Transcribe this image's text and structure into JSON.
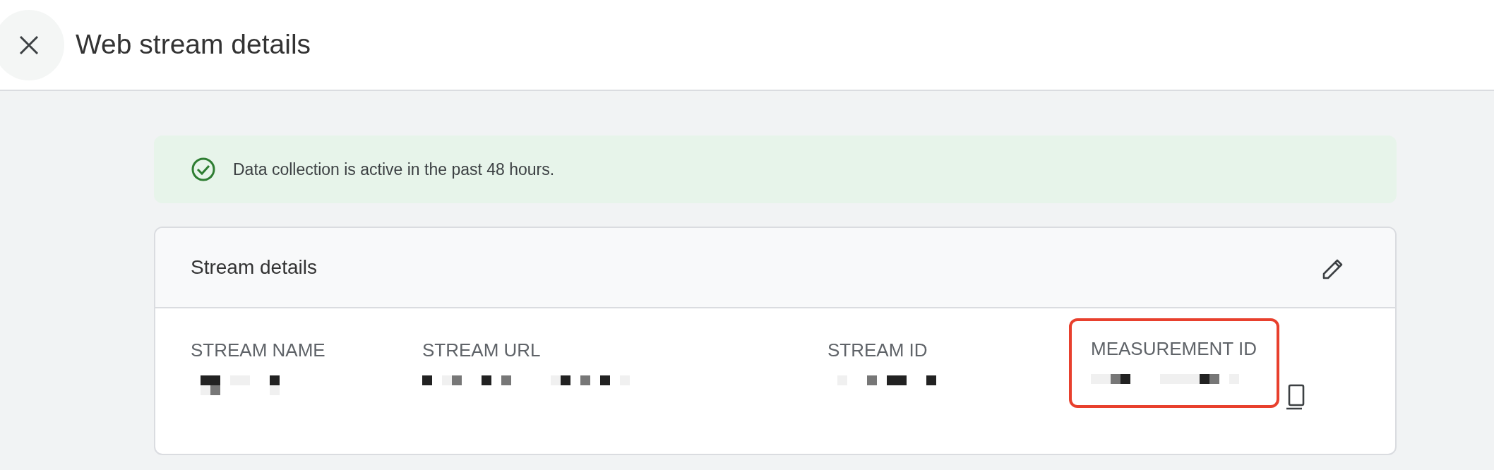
{
  "header": {
    "title": "Web stream details"
  },
  "banner": {
    "kind": "success",
    "text": "Data collection is active in the past 48 hours."
  },
  "card": {
    "title": "Stream details",
    "editable": true,
    "fields": [
      {
        "label": "STREAM NAME",
        "highlighted": false,
        "copyable": false
      },
      {
        "label": "STREAM URL",
        "highlighted": false,
        "copyable": false
      },
      {
        "label": "STREAM ID",
        "highlighted": false,
        "copyable": false
      },
      {
        "label": "MEASUREMENT ID",
        "highlighted": true,
        "copyable": true
      }
    ]
  }
}
